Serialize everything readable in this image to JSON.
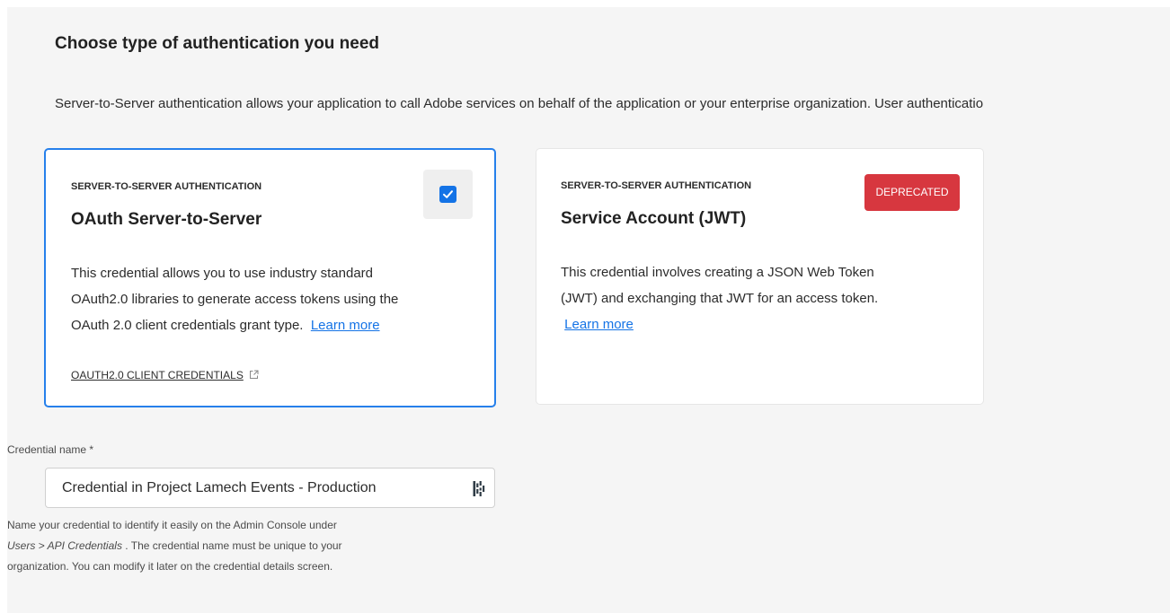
{
  "header": {
    "title": "Choose type of authentication you need",
    "description": "Server-to-Server authentication allows your application to call Adobe services on behalf of the application or your enterprise organization. User authenticatio"
  },
  "cards": [
    {
      "eyebrow": "SERVER-TO-SERVER AUTHENTICATION",
      "title": "OAuth Server-to-Server",
      "body_lines": [
        "This credential allows you to use industry standard",
        "OAuth2.0 libraries to generate access tokens using the",
        "OAuth 2.0 client credentials grant type."
      ],
      "learn_more": "Learn more",
      "footer_link": "OAUTH2.0 CLIENT CREDENTIALS",
      "selected": true,
      "checkbox_icon": "checkmark-icon",
      "footer_icon": "external-link-icon"
    },
    {
      "eyebrow": "SERVER-TO-SERVER AUTHENTICATION",
      "title": "Service Account (JWT)",
      "body_lines": [
        "This credential involves creating a JSON Web Token",
        "(JWT) and exchanging that JWT for an access token."
      ],
      "learn_more": "Learn more",
      "badge": "DEPRECATED",
      "badge_color": "#d7373f",
      "selected": false
    }
  ],
  "credential": {
    "label": "Credential name *",
    "value": "Credential in Project Lamech Events - Production",
    "input_icon": "password-manager-icon",
    "help_parts": [
      "Name your credential to identify it easily on the Admin Console under",
      "Users > API Credentials",
      " . The credential name must be unique to your",
      "organization. You can modify it later on the credential details screen."
    ]
  },
  "colors": {
    "accent": "#1473e6",
    "selected_border": "#2680eb",
    "panel_background": "#f5f5f5"
  }
}
